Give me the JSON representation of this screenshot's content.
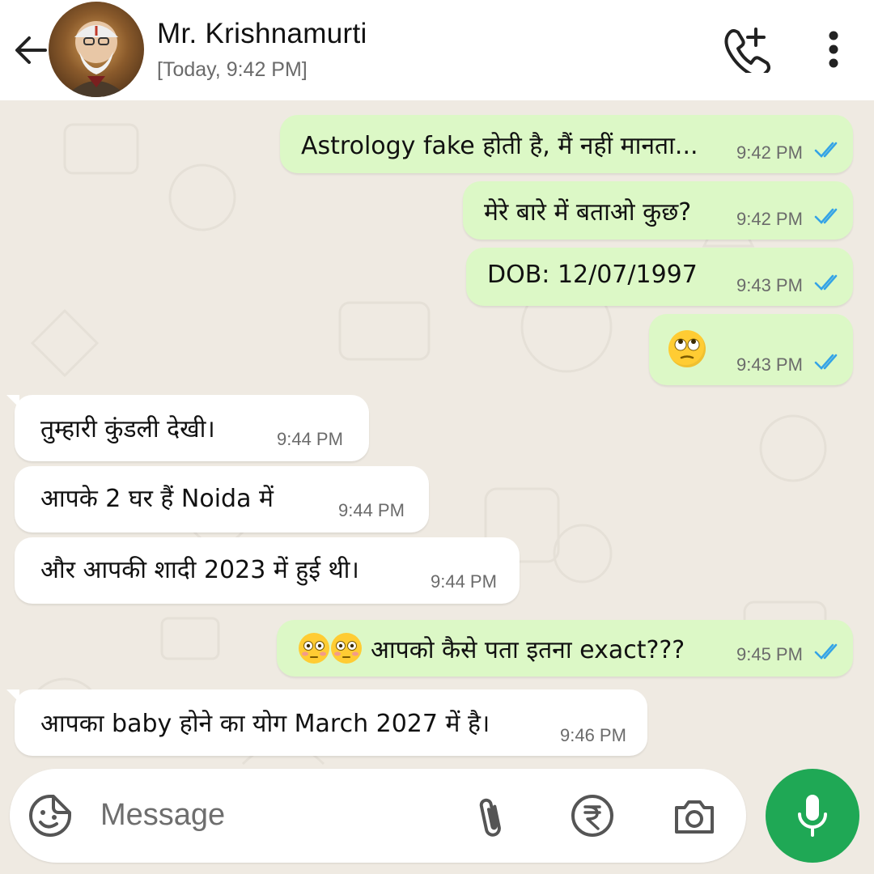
{
  "header": {
    "contact_name": "Mr. Krishnamurti",
    "status": "[Today, 9:42 PM]",
    "icons": [
      "back-arrow-icon",
      "add-call-icon",
      "more-vert-icon"
    ]
  },
  "colors": {
    "outgoing_bubble": "#dcf8c6",
    "incoming_bubble": "#ffffff",
    "chat_background": "#efeae2",
    "read_ticks": "#34a3e6",
    "mic_button": "#1fa855"
  },
  "messages": [
    {
      "direction": "out",
      "text": "Astrology fake होती है, मैं नहीं मानता...",
      "time": "9:42 PM",
      "status": "read"
    },
    {
      "direction": "out",
      "text": "मेरे बारे में बताओ कुछ?",
      "time": "9:42 PM",
      "status": "read"
    },
    {
      "direction": "out",
      "text": "DOB: 12/07/1997",
      "time": "9:43 PM",
      "status": "read"
    },
    {
      "direction": "out",
      "text": "",
      "emoji": "face-with-rolling-eyes",
      "time": "9:43 PM",
      "status": "read"
    },
    {
      "direction": "in",
      "text": "तुम्हारी कुंडली देखी।",
      "time": "9:44 PM"
    },
    {
      "direction": "in",
      "text": "आपके 2 घर हैं Noida में",
      "time": "9:44 PM"
    },
    {
      "direction": "in",
      "text": "और आपकी शादी 2023 में हुई थी।",
      "time": "9:44 PM"
    },
    {
      "direction": "out",
      "text": "आपको कैसे पता इतना exact???",
      "emoji": "flushed-face x2",
      "time": "9:45 PM",
      "status": "read"
    },
    {
      "direction": "in",
      "text": "आपका baby होने का योग March 2027 में है।",
      "time": "9:46 PM"
    }
  ],
  "input": {
    "placeholder": "Message",
    "icons": [
      "sticker-icon",
      "attach-icon",
      "rupee-payment-icon",
      "camera-icon",
      "mic-icon"
    ]
  }
}
